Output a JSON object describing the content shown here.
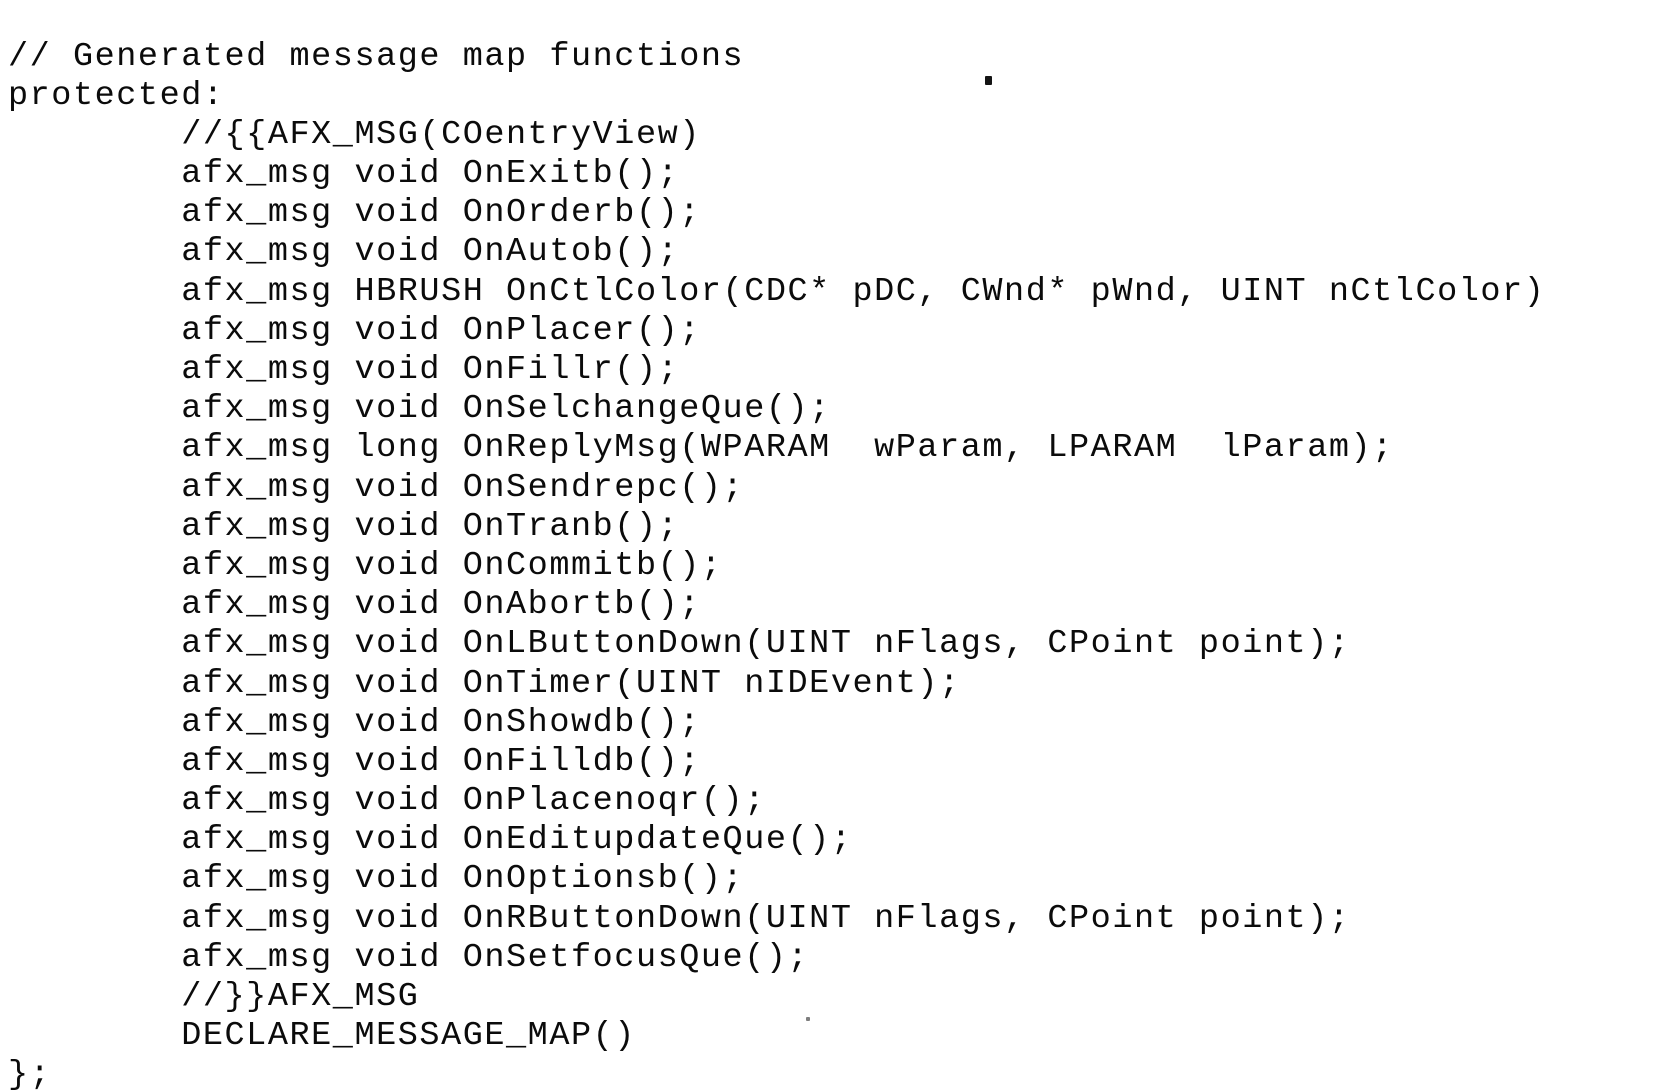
{
  "document": {
    "kind": "scanned-code-listing",
    "language": "cpp",
    "background_color": "#ffffff",
    "text_color": "#0b0b0b",
    "class_name": "COentryView",
    "artifacts": [
      "scan-speck-upper-right",
      "scan-speck-lower-left"
    ]
  },
  "code": {
    "lines": [
      "// Generated message map functions",
      "protected:",
      "        //{{AFX_MSG(COentryView)",
      "        afx_msg void OnExitb();",
      "        afx_msg void OnOrderb();",
      "        afx_msg void OnAutob();",
      "        afx_msg HBRUSH OnCtlColor(CDC* pDC, CWnd* pWnd, UINT nCtlColor)",
      "        afx_msg void OnPlacer();",
      "        afx_msg void OnFillr();",
      "        afx_msg void OnSelchangeQue();",
      "        afx_msg long OnReplyMsg(WPARAM  wParam, LPARAM  lParam);",
      "        afx_msg void OnSendrepc();",
      "        afx_msg void OnTranb();",
      "        afx_msg void OnCommitb();",
      "        afx_msg void OnAbortb();",
      "        afx_msg void OnLButtonDown(UINT nFlags, CPoint point);",
      "        afx_msg void OnTimer(UINT nIDEvent);",
      "        afx_msg void OnShowdb();",
      "        afx_msg void OnFilldb();",
      "        afx_msg void OnPlacenoqr();",
      "        afx_msg void OnEditupdateQue();",
      "        afx_msg void OnOptionsb();",
      "        afx_msg void OnRButtonDown(UINT nFlags, CPoint point);",
      "        afx_msg void OnSetfocusQue();",
      "        //}}AFX_MSG",
      "        DECLARE_MESSAGE_MAP()",
      "};"
    ]
  }
}
